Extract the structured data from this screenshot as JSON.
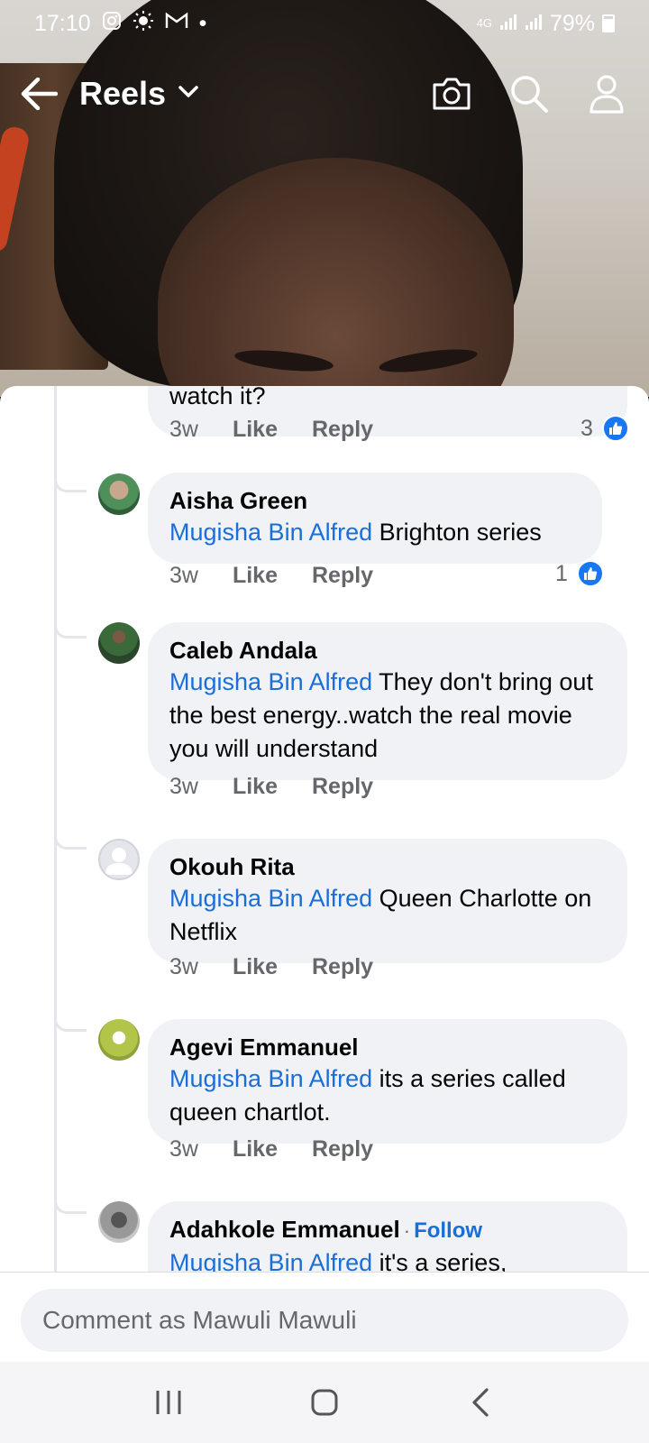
{
  "status_bar": {
    "time": "17:10",
    "network": "4G",
    "battery": "79%"
  },
  "app_bar": {
    "title": "Reels"
  },
  "previous_comment": {
    "cut_text": "watch it?",
    "time": "3w",
    "like": "Like",
    "reply": "Reply",
    "reactions": "3"
  },
  "comments": [
    {
      "name": "Aisha Green",
      "mention": "Mugisha Bin Alfred",
      "text": " Brighton series",
      "time": "3w",
      "like": "Like",
      "reply": "Reply",
      "reactions": "1"
    },
    {
      "name": "Caleb Andala",
      "mention": "Mugisha Bin Alfred",
      "text": " They don't bring out the best energy..watch the real movie you will understand",
      "time": "3w",
      "like": "Like",
      "reply": "Reply"
    },
    {
      "name": "Okouh Rita",
      "mention": "Mugisha Bin Alfred",
      "text": " Queen Charlotte on Netflix",
      "time": "3w",
      "like": "Like",
      "reply": "Reply"
    },
    {
      "name": "Agevi Emmanuel",
      "mention": "Mugisha Bin Alfred",
      "text": " its a series called queen chartlot.",
      "time": "3w",
      "like": "Like",
      "reply": "Reply"
    },
    {
      "name": "Adahkole Emmanuel",
      "follow": "Follow",
      "mention": "Mugisha Bin Alfred",
      "text": " it's a series,"
    }
  ],
  "composer": {
    "placeholder": "Comment as Mawuli Mawuli"
  },
  "colors": {
    "link": "#1a6ed8",
    "like_badge": "#1877f2",
    "bubble": "#f0f2f5",
    "meta": "#65676b"
  }
}
